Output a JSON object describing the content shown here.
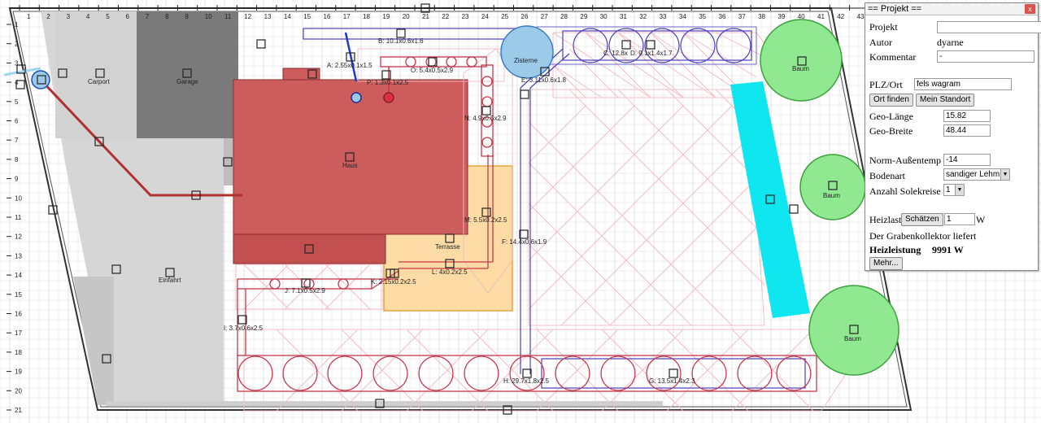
{
  "panel": {
    "title": "== Projekt ==",
    "close_label": "x",
    "projekt_label": "Projekt",
    "projekt_value": "",
    "autor_label": "Autor",
    "autor_value": "dyarne",
    "kommentar_label": "Kommentar",
    "kommentar_value": "-",
    "plz_label": "PLZ/Ort",
    "plz_value": "fels wagram",
    "ort_finden": "Ort finden",
    "mein_standort": "Mein Standort",
    "geo_laenge_label": "Geo-Länge",
    "geo_laenge_value": "15.82",
    "geo_breite_label": "Geo-Breite",
    "geo_breite_value": "48.44",
    "norm_label": "Norm-Außentemp",
    "norm_value": "-14",
    "bodenart_label": "Bodenart",
    "bodenart_value": "sandiger Lehm",
    "solekreise_label": "Anzahl Solekreise",
    "solekreise_value": "1",
    "heizlast_label": "Heizlast",
    "schaetzen": "Schätzen",
    "heizlast_value": "1",
    "heizlast_unit": "W",
    "liefert_text": "Der Grabenkollektor liefert",
    "heizleistung_label": "Heizleistung",
    "heizleistung_value": "9991 W",
    "mehr": "Mehr..."
  },
  "ruler": {
    "top": [
      "1",
      "2",
      "3",
      "4",
      "5",
      "6",
      "7",
      "8",
      "9",
      "10",
      "11",
      "12",
      "13",
      "14",
      "15",
      "16",
      "17",
      "18",
      "19",
      "20",
      "21",
      "22",
      "23",
      "24",
      "25",
      "26",
      "27",
      "28",
      "29",
      "30",
      "31",
      "32",
      "33",
      "34",
      "35",
      "36",
      "37",
      "38",
      "39",
      "40",
      "41",
      "42",
      "43"
    ],
    "left": [
      "1",
      "2",
      "3",
      "4",
      "5",
      "6",
      "7",
      "8",
      "9",
      "10",
      "11",
      "12",
      "13",
      "14",
      "15",
      "16",
      "17",
      "18",
      "19",
      "20",
      "21"
    ]
  },
  "areas": {
    "carport": "Carport",
    "garage": "Garage",
    "haus": "Haus",
    "terrasse": "Terrasse",
    "einfahrt": "Einfahrt",
    "zisterne": "Zisterne",
    "baum1": "Baum",
    "baum2": "Baum",
    "baum3": "Baum"
  },
  "pipes": {
    "A": "A: 2.55x0.1x1.5",
    "B": "B: 10.1x0.6x1.6",
    "C": "C: 12.8x",
    "D": "D: 9.1x1.4x1.7",
    "E": "E: 3.11x0.6x1.8",
    "F": "F: 14.4x0.6x1.9",
    "G": "G: 13.5x1.4x2.3",
    "H": "H: 29.7x1.8x2.5",
    "I": "I: 3.7x0.6x2.5",
    "J": "J: 7.1x0.5x2.9",
    "K": "K: 2.15x0.2x2.5",
    "L": "L: 4x0.2x2.5",
    "M": "M: 5.5x0.2x2.5",
    "N": "N: 4.9x0.5x2.9",
    "O": "O: 5.4x0.5x2.9",
    "P": "P: 1.3x0.1x2.5"
  }
}
